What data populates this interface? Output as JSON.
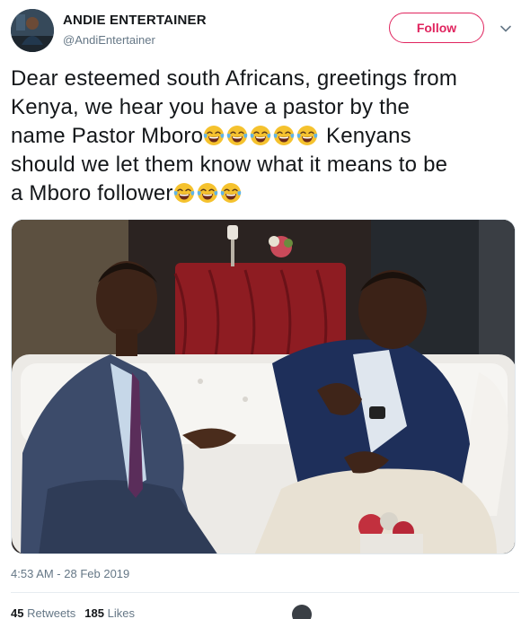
{
  "header": {
    "display_name": "ANDIE ENTERTAINER",
    "handle": "@AndiEntertainer",
    "follow_label": "Follow",
    "avatar_icon": "profile-avatar",
    "caret_icon": "chevron-down-icon"
  },
  "tweet": {
    "text_line1": "Dear esteemed south Africans, greetings from",
    "text_line2": "Kenya, we hear you have a pastor by the",
    "text_line3a": "name Pastor Mboro",
    "text_line3b": " Kenyans",
    "text_line4": "should we let them know what it means to be",
    "text_line5": "a Mboro follower",
    "emoji_name": "face-with-tears-of-joy"
  },
  "photo": {
    "description_icon": "photo-two-men-on-white-sofa"
  },
  "footer": {
    "timestamp": "4:53 AM - 28 Feb 2019",
    "retweets_count": "45",
    "retweets_label": "Retweets",
    "likes_count": "185",
    "likes_label": "Likes"
  },
  "colors": {
    "accent": "#e0245e",
    "secondary_text": "#657786",
    "primary_text": "#14171a"
  }
}
